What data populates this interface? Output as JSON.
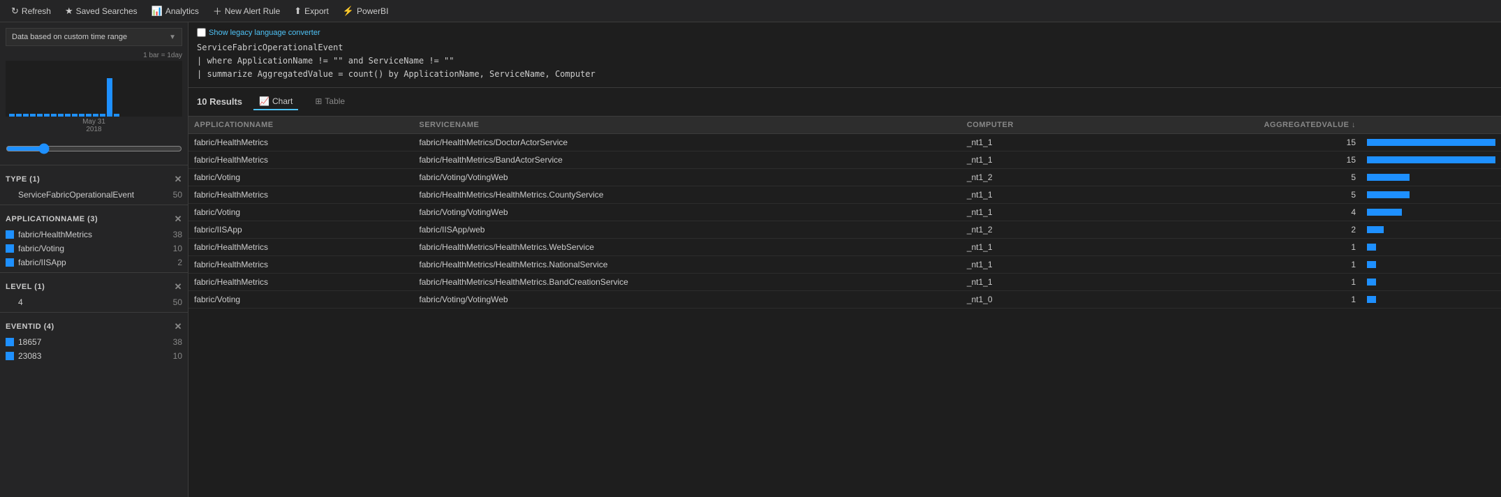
{
  "nav": {
    "refresh_label": "Refresh",
    "saved_searches_label": "Saved Searches",
    "analytics_label": "Analytics",
    "new_alert_label": "New Alert Rule",
    "export_label": "Export",
    "powerbi_label": "PowerBI"
  },
  "left_panel": {
    "time_range_label": "Data based on custom time range",
    "histogram_bar_label": "1 bar = 1day",
    "histogram_date": "May 31",
    "histogram_year": "2018",
    "filters": [
      {
        "id": "type",
        "header": "TYPE (1)",
        "items": [
          {
            "name": "ServiceFabricOperationalEvent",
            "count": 50,
            "has_swatch": false
          }
        ]
      },
      {
        "id": "applicationname",
        "header": "APPLICATIONNAME (3)",
        "items": [
          {
            "name": "fabric/HealthMetrics",
            "count": 38,
            "has_swatch": true
          },
          {
            "name": "fabric/Voting",
            "count": 10,
            "has_swatch": true
          },
          {
            "name": "fabric/IISApp",
            "count": 2,
            "has_swatch": true
          }
        ]
      },
      {
        "id": "level",
        "header": "LEVEL (1)",
        "items": [
          {
            "name": "4",
            "count": 50,
            "has_swatch": false
          }
        ]
      },
      {
        "id": "eventid",
        "header": "EVENTID (4)",
        "items": [
          {
            "name": "18657",
            "count": 38,
            "has_swatch": true
          },
          {
            "name": "23083",
            "count": 10,
            "has_swatch": true
          }
        ]
      }
    ]
  },
  "query": {
    "legacy_toggle_label": "Show legacy language converter",
    "lines": [
      "ServiceFabricOperationalEvent",
      "| where ApplicationName != \"\" and ServiceName != \"\"",
      "| summarize AggregatedValue = count() by ApplicationName, ServiceName, Computer"
    ]
  },
  "results": {
    "count_label": "10 Results",
    "count": 10,
    "tab_chart": "Chart",
    "tab_table": "Table",
    "active_tab": "chart",
    "columns": [
      {
        "id": "applicationname",
        "label": "APPLICATIONNAME"
      },
      {
        "id": "servicename",
        "label": "SERVICENAME"
      },
      {
        "id": "computer",
        "label": "COMPUTER"
      },
      {
        "id": "aggregatedvalue",
        "label": "AGGREGATEDVALUE ↓"
      },
      {
        "id": "bar",
        "label": ""
      }
    ],
    "rows": [
      {
        "applicationname": "fabric/HealthMetrics",
        "servicename": "fabric/HealthMetrics/DoctorActorService",
        "computer": "_nt1_1",
        "aggregatedvalue": 15,
        "bar_pct": 100
      },
      {
        "applicationname": "fabric/HealthMetrics",
        "servicename": "fabric/HealthMetrics/BandActorService",
        "computer": "_nt1_1",
        "aggregatedvalue": 15,
        "bar_pct": 100
      },
      {
        "applicationname": "fabric/Voting",
        "servicename": "fabric/Voting/VotingWeb",
        "computer": "_nt1_2",
        "aggregatedvalue": 5,
        "bar_pct": 33
      },
      {
        "applicationname": "fabric/HealthMetrics",
        "servicename": "fabric/HealthMetrics/HealthMetrics.CountyService",
        "computer": "_nt1_1",
        "aggregatedvalue": 5,
        "bar_pct": 33
      },
      {
        "applicationname": "fabric/Voting",
        "servicename": "fabric/Voting/VotingWeb",
        "computer": "_nt1_1",
        "aggregatedvalue": 4,
        "bar_pct": 27
      },
      {
        "applicationname": "fabric/IISApp",
        "servicename": "fabric/IISApp/web",
        "computer": "_nt1_2",
        "aggregatedvalue": 2,
        "bar_pct": 13
      },
      {
        "applicationname": "fabric/HealthMetrics",
        "servicename": "fabric/HealthMetrics/HealthMetrics.WebService",
        "computer": "_nt1_1",
        "aggregatedvalue": 1,
        "bar_pct": 7
      },
      {
        "applicationname": "fabric/HealthMetrics",
        "servicename": "fabric/HealthMetrics/HealthMetrics.NationalService",
        "computer": "_nt1_1",
        "aggregatedvalue": 1,
        "bar_pct": 7
      },
      {
        "applicationname": "fabric/HealthMetrics",
        "servicename": "fabric/HealthMetrics/HealthMetrics.BandCreationService",
        "computer": "_nt1_1",
        "aggregatedvalue": 1,
        "bar_pct": 7
      },
      {
        "applicationname": "fabric/Voting",
        "servicename": "fabric/Voting/VotingWeb",
        "computer": "_nt1_0",
        "aggregatedvalue": 1,
        "bar_pct": 7
      }
    ]
  },
  "colors": {
    "accent_blue": "#1e90ff",
    "text_primary": "#cccccc",
    "bg_dark": "#1e1e1e",
    "bg_panel": "#252526"
  }
}
